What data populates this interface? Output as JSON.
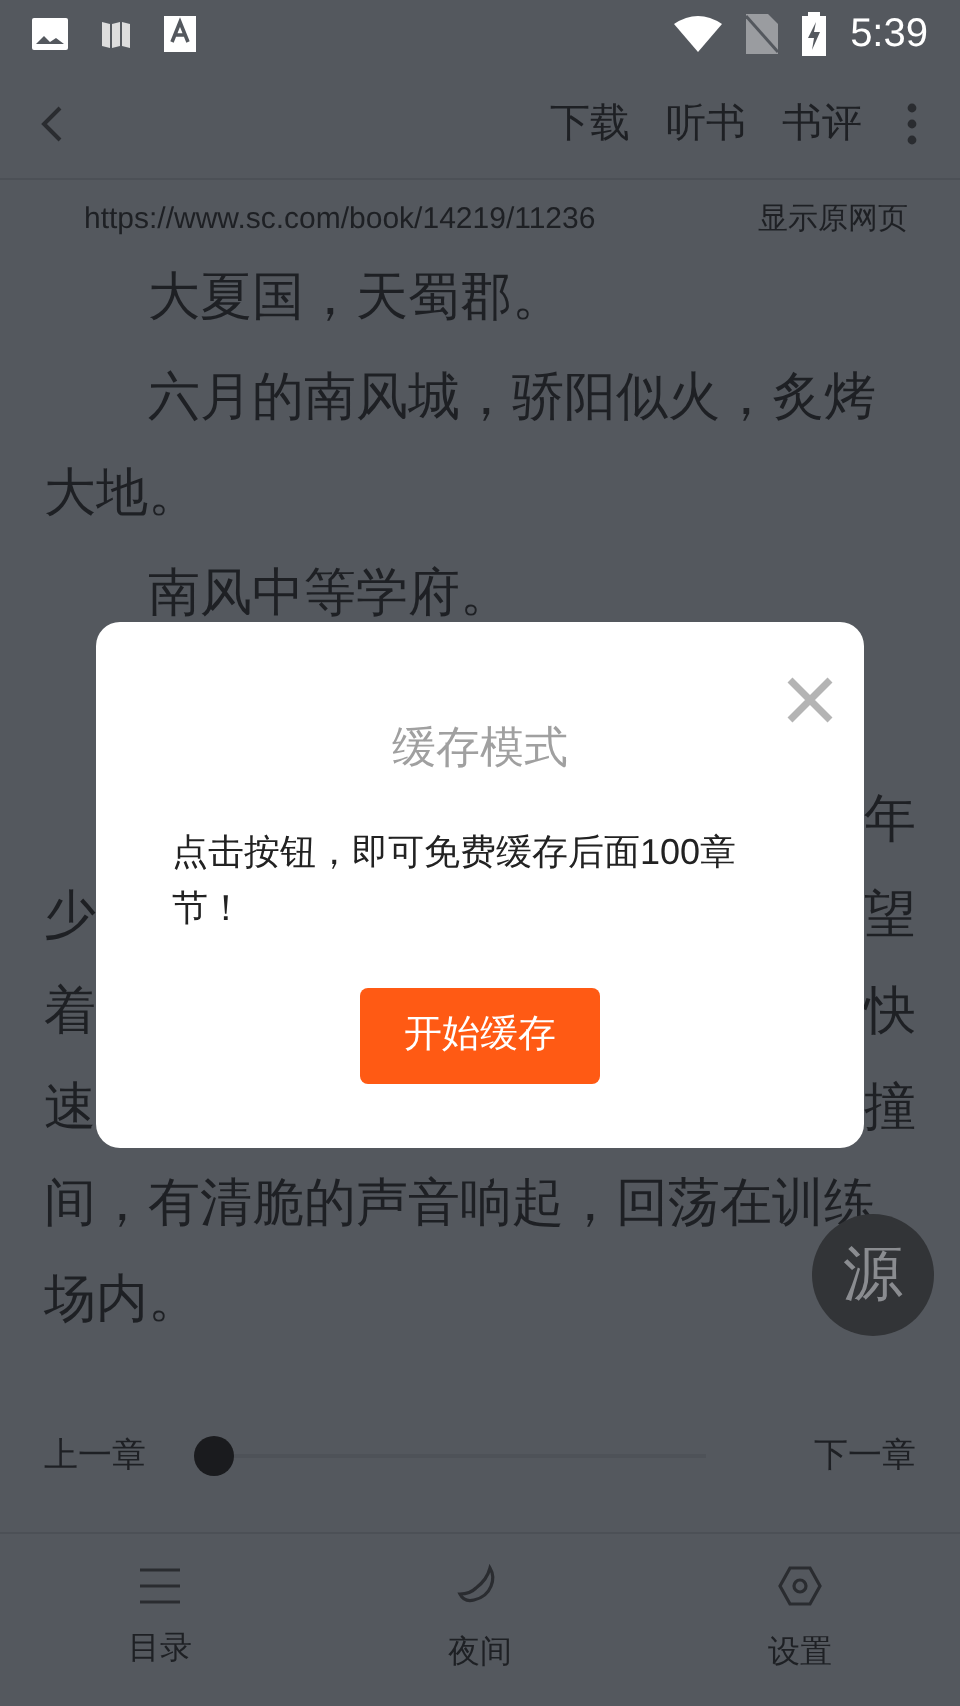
{
  "status_bar": {
    "time": "5:39"
  },
  "toolbar": {
    "actions": [
      {
        "label": "下载"
      },
      {
        "label": "听书"
      },
      {
        "label": "书评"
      }
    ]
  },
  "source": {
    "url": "https://www.sc.com/book/14219/11236",
    "link": "显示原网页"
  },
  "content": {
    "paragraphs": [
      "大夏国，天蜀郡。",
      "六月的南风城，骄阳似火，炙烤大地。",
      "南风中等学府。"
    ],
    "partial_lines": [
      {
        "right": "年"
      },
      {
        "left": "少",
        "right": "望"
      },
      {
        "left": "着",
        "right": "快"
      },
      {
        "left": "速",
        "right": "撞"
      }
    ],
    "tail_lines": [
      "间，有清脆的声音响起，回荡在训练",
      "场内。"
    ]
  },
  "source_button": {
    "label": "源"
  },
  "chapter_bar": {
    "prev": "上一章",
    "next": "下一章",
    "level": 0
  },
  "bottom_nav": [
    {
      "kind": "menu",
      "label": "目录"
    },
    {
      "kind": "moon",
      "label": "夜间"
    },
    {
      "kind": "gear",
      "label": "设置"
    }
  ],
  "dialog": {
    "title": "缓存模式",
    "message": "点击按钮，即可免费缓存后面100章节！",
    "button": "开始缓存"
  }
}
